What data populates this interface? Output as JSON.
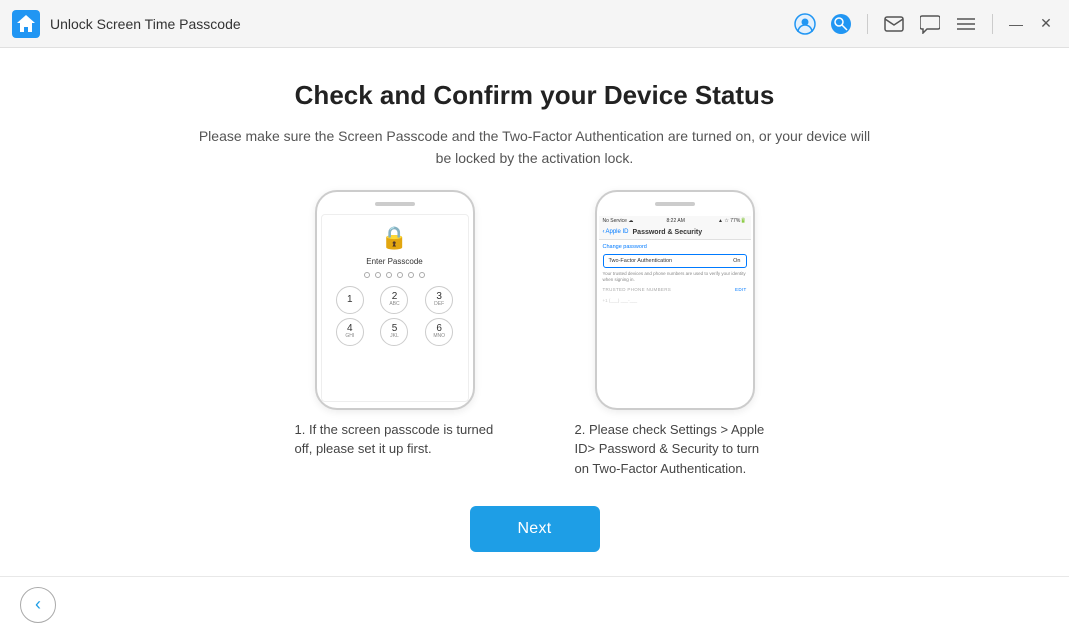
{
  "titlebar": {
    "title": "Unlock Screen Time Passcode",
    "icon_alt": "app-icon"
  },
  "header": {
    "heading": "Check and Confirm your Device Status",
    "subtext": "Please make sure the Screen Passcode and the Two-Factor Authentication are turned on, or your device will be locked by the activation lock."
  },
  "illustrations": [
    {
      "id": "passcode-screen",
      "lock_label": "🔒",
      "enter_passcode": "Enter Passcode",
      "keypad": [
        {
          "num": "1",
          "letters": ""
        },
        {
          "num": "2",
          "letters": "ABC"
        },
        {
          "num": "3",
          "letters": "DEF"
        },
        {
          "num": "4",
          "letters": "GHI"
        },
        {
          "num": "5",
          "letters": "JKL"
        },
        {
          "num": "6",
          "letters": "MNO"
        }
      ]
    },
    {
      "id": "settings-screen",
      "status_left": "No Service ☁",
      "status_center": "8:22 AM",
      "status_right": "▲ ☆ 77% 🔋",
      "back_text": "< Apple ID",
      "nav_title": "Password & Security",
      "change_password": "Change password",
      "two_factor_label": "Two-Factor Authentication",
      "two_factor_value": "On",
      "trusted_phone_label": "TRUSTED PHONE NUMBERS",
      "edit_label": "Edit"
    }
  ],
  "descriptions": [
    {
      "text": "1. If the screen passcode is turned off, please set it up first."
    },
    {
      "text": "2. Please check Settings > Apple ID> Password & Security to turn on Two-Factor Authentication."
    }
  ],
  "buttons": {
    "next": "Next",
    "back": "‹"
  }
}
